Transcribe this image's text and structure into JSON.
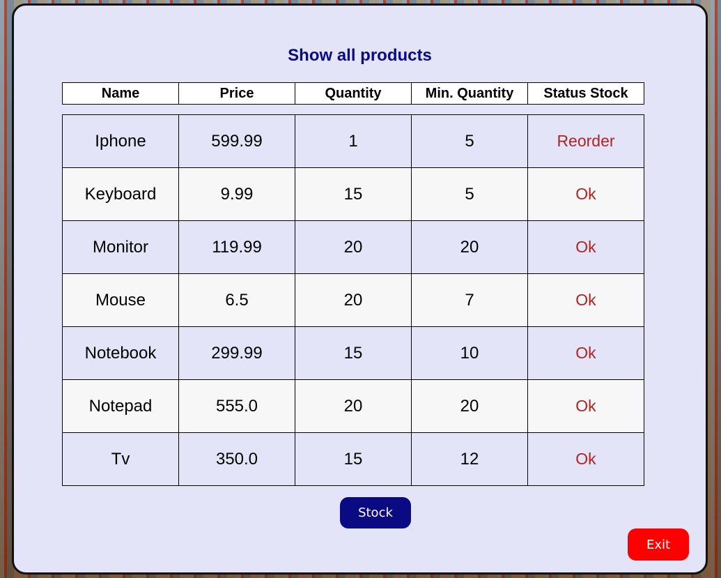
{
  "title": "Show all products",
  "columns": [
    "Name",
    "Price",
    "Quantity",
    "Min. Quantity",
    "Status Stock"
  ],
  "rows": [
    {
      "name": "Iphone",
      "price": "599.99",
      "quantity": "1",
      "min_quantity": "5",
      "status": "Reorder"
    },
    {
      "name": "Keyboard",
      "price": "9.99",
      "quantity": "15",
      "min_quantity": "5",
      "status": "Ok"
    },
    {
      "name": "Monitor",
      "price": "119.99",
      "quantity": "20",
      "min_quantity": "20",
      "status": "Ok"
    },
    {
      "name": "Mouse",
      "price": "6.5",
      "quantity": "20",
      "min_quantity": "7",
      "status": "Ok"
    },
    {
      "name": "Notebook",
      "price": "299.99",
      "quantity": "15",
      "min_quantity": "10",
      "status": "Ok"
    },
    {
      "name": "Notepad",
      "price": "555.0",
      "quantity": "20",
      "min_quantity": "20",
      "status": "Ok"
    },
    {
      "name": "Tv",
      "price": "350.0",
      "quantity": "15",
      "min_quantity": "12",
      "status": "Ok"
    }
  ],
  "buttons": {
    "stock": "Stock",
    "exit": "Exit"
  },
  "colors": {
    "title": "#0a0a82",
    "stock_button": "#0a0a82",
    "exit_button": "#ff0000",
    "status_text": "#b02323"
  }
}
